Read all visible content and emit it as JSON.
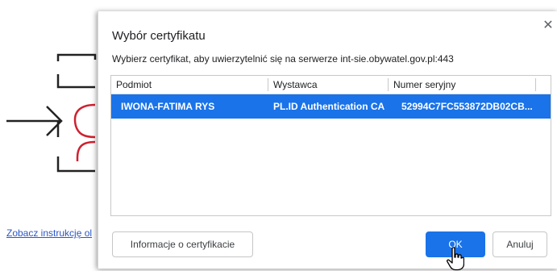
{
  "background": {
    "link_text": "Zobacz instrukcję ol",
    "accent_color": "#d0202f"
  },
  "dialog": {
    "title": "Wybór certyfikatu",
    "close_icon": "close-icon",
    "description": "Wybierz certyfikat, aby uwierzytelnić się na serwerze int-sie.obywatel.gov.pl:443",
    "columns": [
      "Podmiot",
      "Wystawca",
      "Numer seryjny"
    ],
    "rows": [
      {
        "subject": "IWONA-FATIMA RYS",
        "issuer": "PL.ID Authentication CA",
        "serial": "52994C7FC553872DB02CB..."
      }
    ],
    "buttons": {
      "info": "Informacje o certyfikacie",
      "ok": "OK",
      "cancel": "Anuluj"
    },
    "selected_row_color": "#1a73e8"
  }
}
